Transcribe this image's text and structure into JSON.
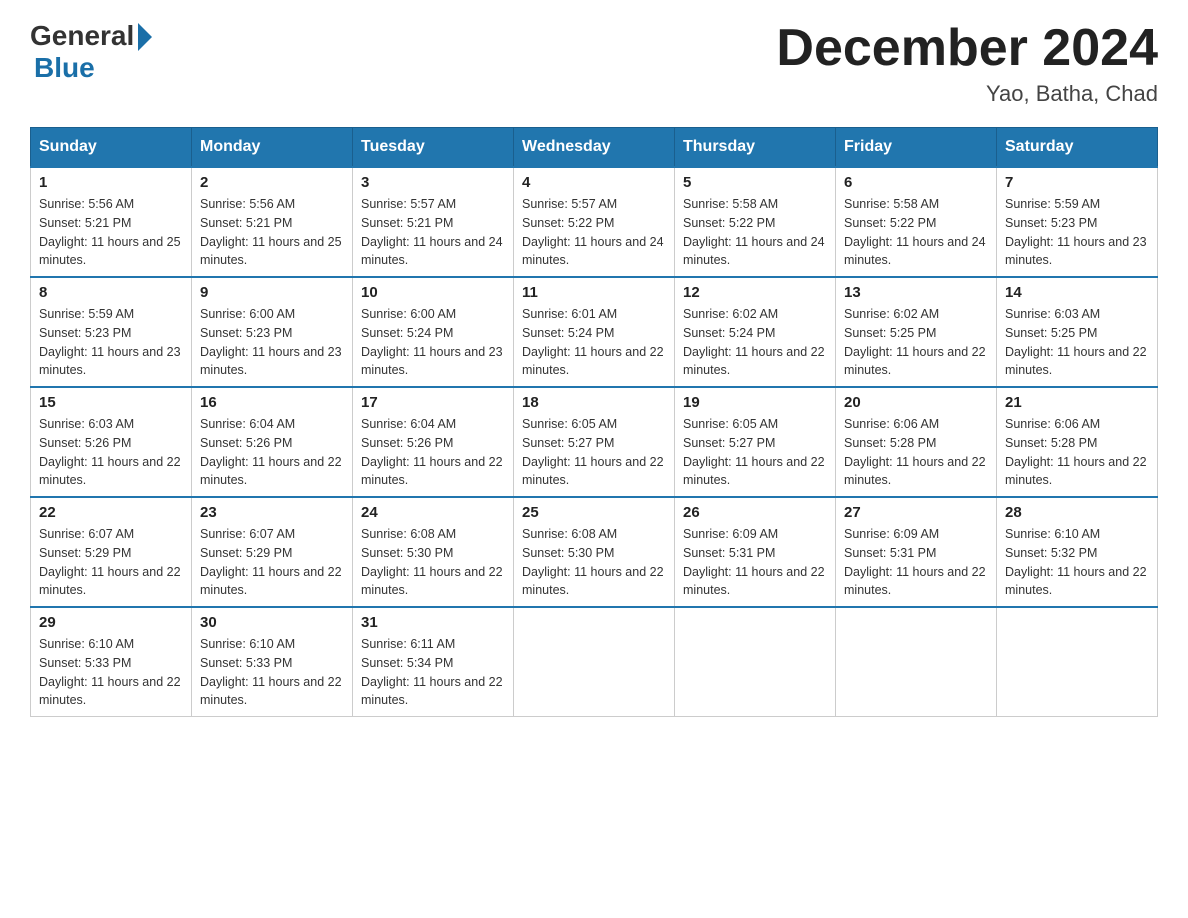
{
  "header": {
    "logo": {
      "general": "General",
      "blue": "Blue"
    },
    "title": "December 2024",
    "location": "Yao, Batha, Chad"
  },
  "days_of_week": [
    "Sunday",
    "Monday",
    "Tuesday",
    "Wednesday",
    "Thursday",
    "Friday",
    "Saturday"
  ],
  "weeks": [
    [
      {
        "day": "1",
        "sunrise": "5:56 AM",
        "sunset": "5:21 PM",
        "daylight": "11 hours and 25 minutes."
      },
      {
        "day": "2",
        "sunrise": "5:56 AM",
        "sunset": "5:21 PM",
        "daylight": "11 hours and 25 minutes."
      },
      {
        "day": "3",
        "sunrise": "5:57 AM",
        "sunset": "5:21 PM",
        "daylight": "11 hours and 24 minutes."
      },
      {
        "day": "4",
        "sunrise": "5:57 AM",
        "sunset": "5:22 PM",
        "daylight": "11 hours and 24 minutes."
      },
      {
        "day": "5",
        "sunrise": "5:58 AM",
        "sunset": "5:22 PM",
        "daylight": "11 hours and 24 minutes."
      },
      {
        "day": "6",
        "sunrise": "5:58 AM",
        "sunset": "5:22 PM",
        "daylight": "11 hours and 24 minutes."
      },
      {
        "day": "7",
        "sunrise": "5:59 AM",
        "sunset": "5:23 PM",
        "daylight": "11 hours and 23 minutes."
      }
    ],
    [
      {
        "day": "8",
        "sunrise": "5:59 AM",
        "sunset": "5:23 PM",
        "daylight": "11 hours and 23 minutes."
      },
      {
        "day": "9",
        "sunrise": "6:00 AM",
        "sunset": "5:23 PM",
        "daylight": "11 hours and 23 minutes."
      },
      {
        "day": "10",
        "sunrise": "6:00 AM",
        "sunset": "5:24 PM",
        "daylight": "11 hours and 23 minutes."
      },
      {
        "day": "11",
        "sunrise": "6:01 AM",
        "sunset": "5:24 PM",
        "daylight": "11 hours and 22 minutes."
      },
      {
        "day": "12",
        "sunrise": "6:02 AM",
        "sunset": "5:24 PM",
        "daylight": "11 hours and 22 minutes."
      },
      {
        "day": "13",
        "sunrise": "6:02 AM",
        "sunset": "5:25 PM",
        "daylight": "11 hours and 22 minutes."
      },
      {
        "day": "14",
        "sunrise": "6:03 AM",
        "sunset": "5:25 PM",
        "daylight": "11 hours and 22 minutes."
      }
    ],
    [
      {
        "day": "15",
        "sunrise": "6:03 AM",
        "sunset": "5:26 PM",
        "daylight": "11 hours and 22 minutes."
      },
      {
        "day": "16",
        "sunrise": "6:04 AM",
        "sunset": "5:26 PM",
        "daylight": "11 hours and 22 minutes."
      },
      {
        "day": "17",
        "sunrise": "6:04 AM",
        "sunset": "5:26 PM",
        "daylight": "11 hours and 22 minutes."
      },
      {
        "day": "18",
        "sunrise": "6:05 AM",
        "sunset": "5:27 PM",
        "daylight": "11 hours and 22 minutes."
      },
      {
        "day": "19",
        "sunrise": "6:05 AM",
        "sunset": "5:27 PM",
        "daylight": "11 hours and 22 minutes."
      },
      {
        "day": "20",
        "sunrise": "6:06 AM",
        "sunset": "5:28 PM",
        "daylight": "11 hours and 22 minutes."
      },
      {
        "day": "21",
        "sunrise": "6:06 AM",
        "sunset": "5:28 PM",
        "daylight": "11 hours and 22 minutes."
      }
    ],
    [
      {
        "day": "22",
        "sunrise": "6:07 AM",
        "sunset": "5:29 PM",
        "daylight": "11 hours and 22 minutes."
      },
      {
        "day": "23",
        "sunrise": "6:07 AM",
        "sunset": "5:29 PM",
        "daylight": "11 hours and 22 minutes."
      },
      {
        "day": "24",
        "sunrise": "6:08 AM",
        "sunset": "5:30 PM",
        "daylight": "11 hours and 22 minutes."
      },
      {
        "day": "25",
        "sunrise": "6:08 AM",
        "sunset": "5:30 PM",
        "daylight": "11 hours and 22 minutes."
      },
      {
        "day": "26",
        "sunrise": "6:09 AM",
        "sunset": "5:31 PM",
        "daylight": "11 hours and 22 minutes."
      },
      {
        "day": "27",
        "sunrise": "6:09 AM",
        "sunset": "5:31 PM",
        "daylight": "11 hours and 22 minutes."
      },
      {
        "day": "28",
        "sunrise": "6:10 AM",
        "sunset": "5:32 PM",
        "daylight": "11 hours and 22 minutes."
      }
    ],
    [
      {
        "day": "29",
        "sunrise": "6:10 AM",
        "sunset": "5:33 PM",
        "daylight": "11 hours and 22 minutes."
      },
      {
        "day": "30",
        "sunrise": "6:10 AM",
        "sunset": "5:33 PM",
        "daylight": "11 hours and 22 minutes."
      },
      {
        "day": "31",
        "sunrise": "6:11 AM",
        "sunset": "5:34 PM",
        "daylight": "11 hours and 22 minutes."
      },
      null,
      null,
      null,
      null
    ]
  ]
}
